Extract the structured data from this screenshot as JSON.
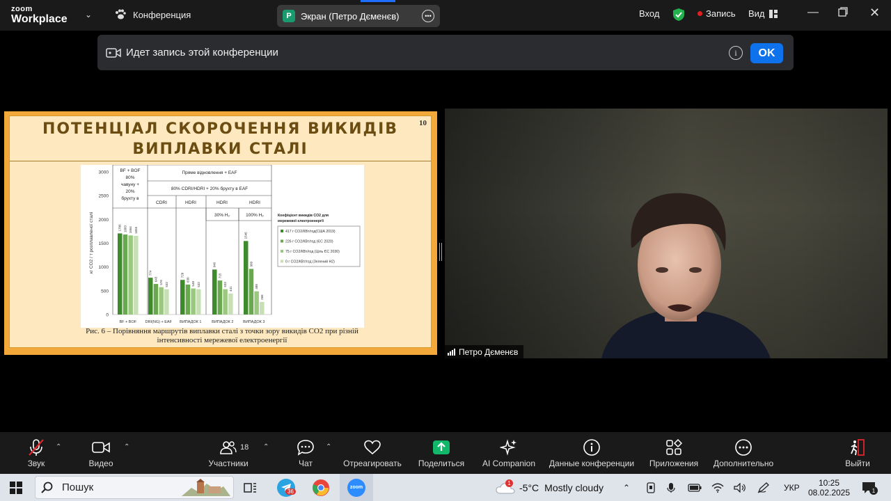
{
  "app": {
    "logo_line1": "zoom",
    "logo_line2": "Workplace",
    "conference_menu": "Конференция",
    "share_title": "Экран (Петро Дєменєв)",
    "share_badge": "P",
    "signin": "Вход",
    "record_label": "Запись",
    "view_label": "Вид"
  },
  "banner": {
    "message": "Идет запись этой конференции",
    "ok_label": "OK"
  },
  "slide": {
    "page_number": "10",
    "title_line1": "ПОТЕНЦІАЛ СКОРОЧЕННЯ ВИКИДІВ",
    "title_line2": "ВИПЛАВКИ СТАЛІ",
    "caption_line1": "Рис. 6 – Порівняння маршрутів виплавки сталі з точки зору викидів CO2 при різній",
    "caption_line2": "інтенсивності мережевої електроенергії"
  },
  "chart_data": {
    "type": "bar",
    "ylabel": "кг CO2 / т розплавленої сталі",
    "ylim": [
      0,
      3000
    ],
    "yticks": [
      "0",
      "500",
      "1000",
      "1500",
      "2000",
      "2500",
      "3000"
    ],
    "categories": [
      "BF + BOF",
      "DRI(NG) + EAF",
      "ВИПАДОК 1",
      "ВИПАДОК 2",
      "ВИПАДОК 3"
    ],
    "series": [
      {
        "name": "417 г CO2/КВт/год(США 2019)",
        "values": [
          1706,
          774,
          728,
          946,
          1546
        ]
      },
      {
        "name": "226 г CO2/КВт/год (ЄС 2020)",
        "values": [
          1683,
          643,
          630,
          715,
          960
        ]
      },
      {
        "name": "75 г CO2/КВт/год (Ціль ЄС 2030)",
        "values": [
          1664,
          576,
          548,
          533,
          488
        ]
      },
      {
        "name": "0 г CO2/КВт/год (Зелений H2)",
        "values": [
          1655,
          532,
          532,
          441,
          266
        ]
      }
    ],
    "colors": [
      "#3f8a2c",
      "#6aa84f",
      "#9bc87f",
      "#c7dfb5"
    ],
    "legend_title": "Коефіцієнт викидів CO2 для мережевої електроенергії",
    "legend_placement": "right",
    "header_cells": {
      "bfbof": [
        "BF + BOF",
        "80%",
        "чавуну +",
        "20%",
        "брухту в"
      ],
      "direct": "Пряме відновлення + EAF",
      "dri_mix": "80% CDRI/HDRI + 20% брухту в EAF",
      "cdri": "CDRI",
      "hdri1": "HDRI",
      "hdri2": "HDRI",
      "hdri3": "HDRI",
      "h2_30": "30% H₂",
      "h2_100": "100% H₂"
    }
  },
  "camera": {
    "participant_name": "Петро Дєменєв"
  },
  "toolbar": {
    "mute": "Звук",
    "video": "Видео",
    "participants": "Участники",
    "participants_count": "18",
    "chat": "Чат",
    "react": "Отреагировать",
    "share": "Поделиться",
    "ai": "AI Companion",
    "info": "Данные конференции",
    "apps": "Приложения",
    "more": "Дополнительно",
    "leave": "Выйти"
  },
  "taskbar": {
    "search_placeholder": "Пошук",
    "telegram_badge": "36",
    "weather_badge": "1",
    "weather_temp": "-5°C",
    "weather_desc": "Mostly cloudy",
    "lang": "УКР",
    "time": "10:25",
    "date": "08.02.2025",
    "notif_count": "1"
  }
}
